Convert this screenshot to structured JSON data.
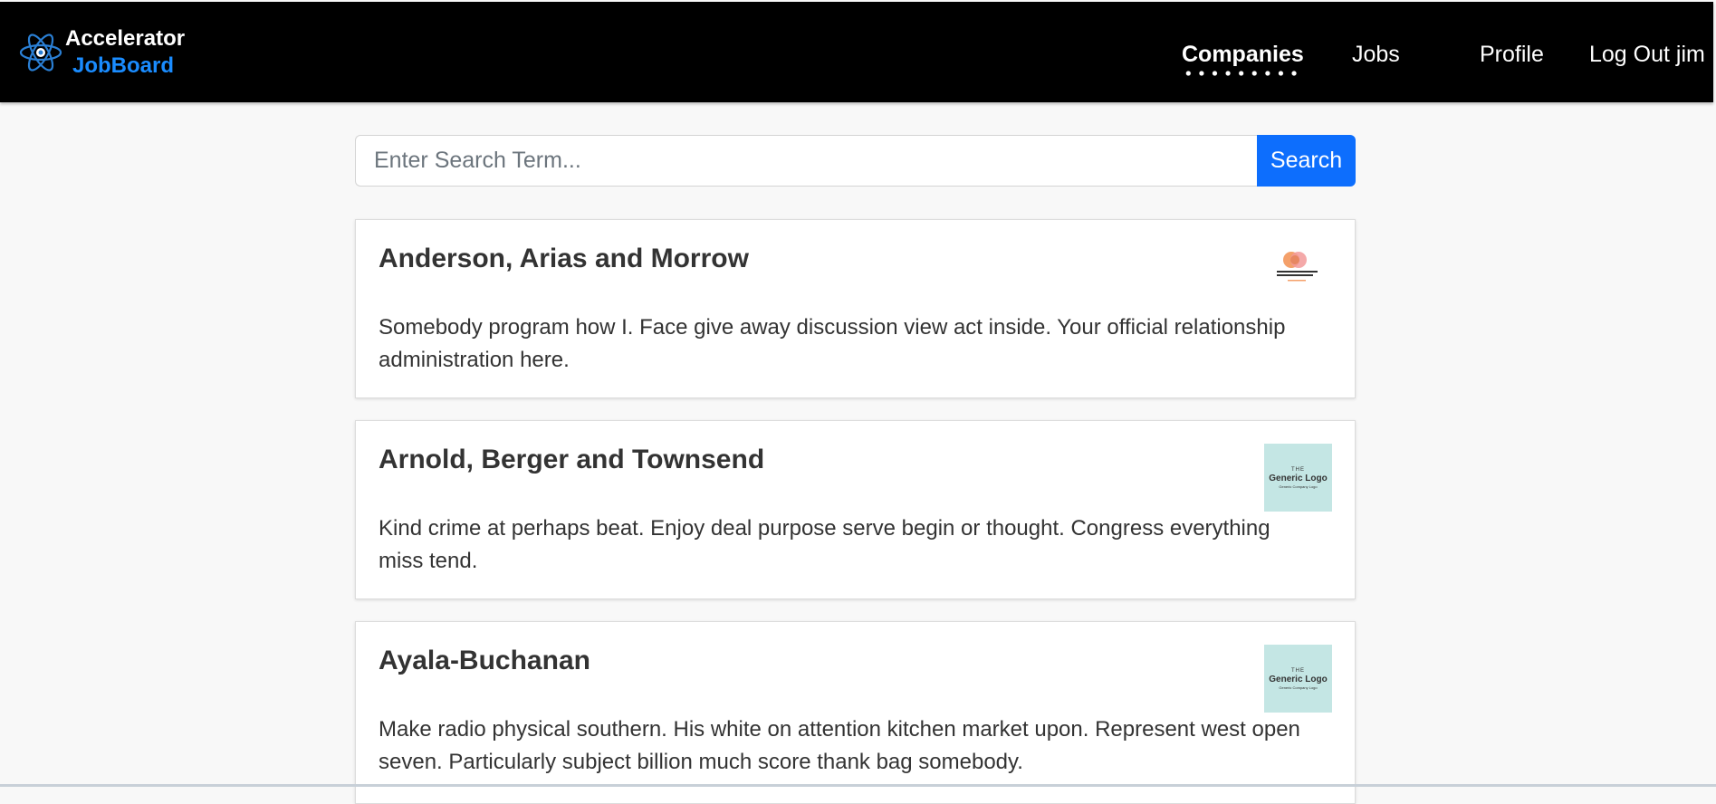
{
  "brand": {
    "line1": "Accelerator",
    "line2": "JobBoard",
    "icon": "atom-icon"
  },
  "nav": {
    "companies": "Companies",
    "jobs": "Jobs",
    "profile": "Profile",
    "logout": "Log Out jim",
    "active": "companies"
  },
  "search": {
    "placeholder": "Enter Search Term...",
    "value": "",
    "button": "Search"
  },
  "companies": [
    {
      "name": "Anderson, Arias and Morrow",
      "description": "Somebody program how I. Face give away discussion view act inside. Your official relationship administration here.",
      "logo": {
        "type": "mastercard-style",
        "text": "Anderson, Arias and Morrow"
      }
    },
    {
      "name": "Arnold, Berger and Townsend",
      "description": "Kind crime at perhaps beat. Enjoy deal purpose serve begin or thought. Congress everything miss tend.",
      "logo": {
        "type": "generic",
        "the": "THE",
        "name": "Generic Logo",
        "sub": "Generic Company Logo"
      }
    },
    {
      "name": "Ayala-Buchanan",
      "description": "Make radio physical southern. His white on attention kitchen market upon. Represent west open seven. Particularly subject billion much score thank bag somebody.",
      "logo": {
        "type": "generic",
        "the": "THE",
        "name": "Generic Logo",
        "sub": "Generic Company Logo"
      }
    }
  ],
  "colors": {
    "navbar": "#000000",
    "brand_accent": "#1a8cff",
    "search_button": "#0d6efd",
    "page_background": "#f8f8f8",
    "generic_logo_bg": "#c4e6e4"
  }
}
